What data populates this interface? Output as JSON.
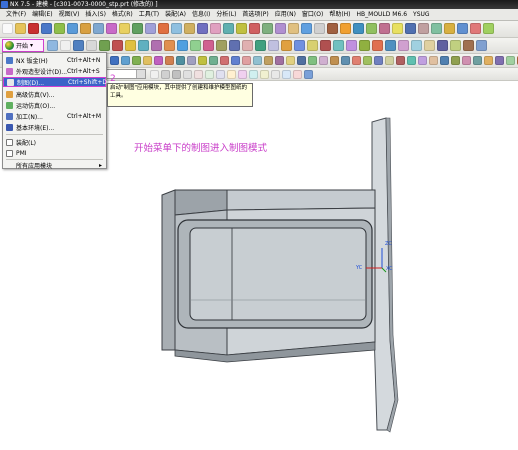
{
  "window": {
    "title": "NX 7.5 - 建模 - [c301-0073-0000_stp.prt (修改的) ]"
  },
  "menubar": {
    "items": [
      "文件(F)",
      "编辑(E)",
      "视图(V)",
      "插入(S)",
      "格式(R)",
      "工具(T)",
      "装配(A)",
      "信息(I)",
      "分析(L)",
      "首选项(P)",
      "应用(N)",
      "窗口(O)",
      "帮助(H)",
      "HB_MOULD M6.6",
      "YSUG"
    ]
  },
  "toolbar": {
    "start_label": "开始"
  },
  "start_menu": {
    "items": [
      {
        "label": "NX 钣金(H)",
        "shortcut": "Ctrl+Alt+N",
        "icon": "sheet-metal-icon"
      },
      {
        "label": "外观造型设计(D)...",
        "shortcut": "Ctrl+Alt+S",
        "icon": "shape-studio-icon"
      },
      {
        "label": "制图(D)...",
        "shortcut": "Ctrl+Shift+D",
        "icon": "drafting-icon",
        "highlighted": true
      },
      {
        "label": "高级仿真(V)...",
        "shortcut": "",
        "icon": "advanced-simulation-icon"
      },
      {
        "label": "运动仿真(O)...",
        "shortcut": "",
        "icon": "motion-simulation-icon"
      },
      {
        "label": "加工(N)...",
        "shortcut": "Ctrl+Alt+M",
        "icon": "manufacturing-icon"
      },
      {
        "label": "基本环境(E)...",
        "shortcut": "",
        "icon": "gateway-icon"
      },
      {
        "label": "装配(L)",
        "shortcut": "",
        "icon": "checkbox-checked-icon"
      },
      {
        "label": "PMI",
        "shortcut": "",
        "icon": "checkbox-checked-icon"
      },
      {
        "label": "所有应用模块",
        "shortcut": "",
        "icon": "submenu-arrow-icon"
      }
    ]
  },
  "annotation": {
    "step_number": "2",
    "caption": "开始菜单下的制图进入制图模式"
  },
  "tooltip": {
    "text": "启动\"制图\"应用模块，其中提供了创建和维护模型图纸的工具。"
  },
  "triad": {
    "zc": "ZC",
    "yc": "YC",
    "xc": "XC"
  },
  "colors": {
    "title_bar": "#2a2a2a",
    "menu_highlight": "#3b63c8",
    "annotation_magenta": "#c83cc8",
    "tooltip_bg": "#ffffe1",
    "part_gray": "#b9bfc4"
  }
}
